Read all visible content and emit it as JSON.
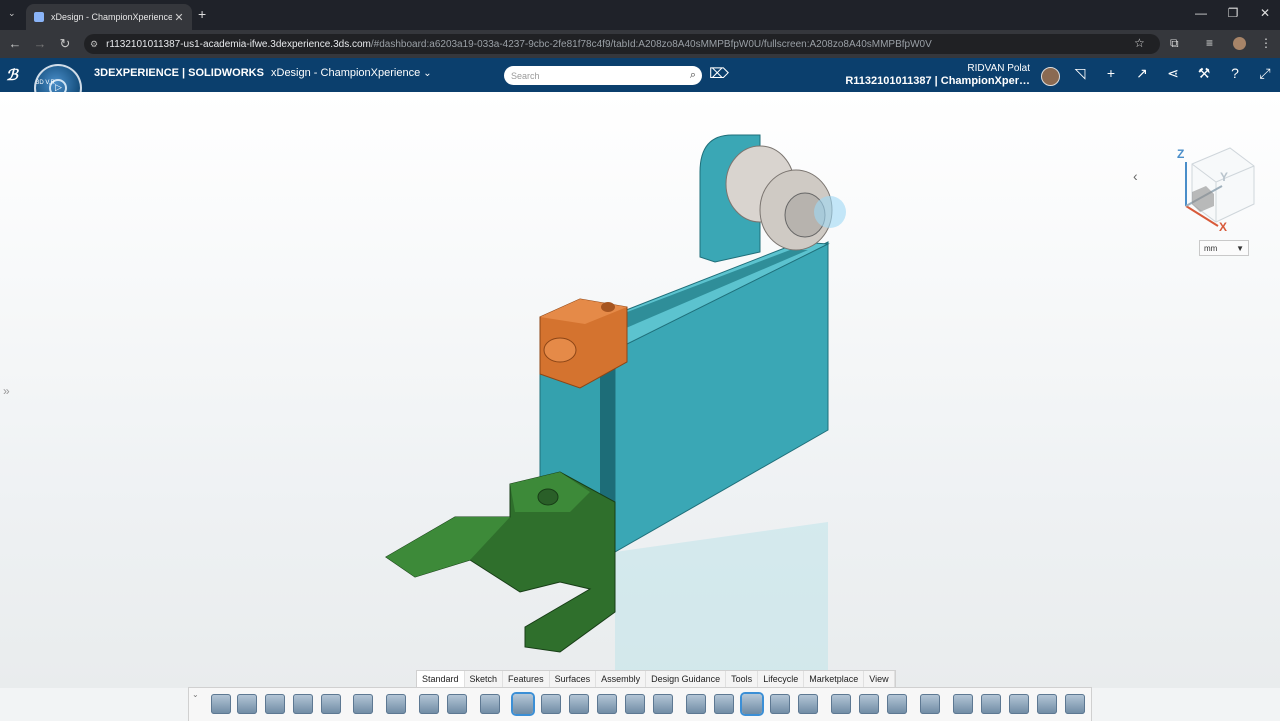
{
  "browser": {
    "tab_title": "xDesign - ChampionXperience",
    "new_tab": "+",
    "window_controls": [
      "—",
      "❐",
      "✕"
    ],
    "url_host": "r1132101011387-us1-academia-ifwe.3dexperience.3ds.com",
    "url_path": "/#dashboard:a6203a19-033a-4237-9cbc-2fe81f78c4f9/tabId:A208zo8A40sMMPBfpW0U/fullscreen:A208zo8A40sMMPBfpW0V"
  },
  "header": {
    "brand_prefix": "3D",
    "brand_experience": "EXPERIENCE | SOLIDWORKS",
    "app_title": "xDesign - ChampionXperience",
    "search_placeholder": "Search",
    "user_name": "RIDVAN Polat",
    "tenant": "R1132101011387 | ChampionXper…",
    "compass_label": "3D V,R"
  },
  "viewcube": {
    "axis_z": "Z",
    "axis_y": "Y",
    "axis_x": "X",
    "unit": "mm"
  },
  "action_tabs": [
    "Standard",
    "Sketch",
    "Features",
    "Surfaces",
    "Assembly",
    "Design Guidance",
    "Tools",
    "Lifecycle",
    "Marketplace",
    "View"
  ],
  "active_tab": "Standard",
  "colors": {
    "header_bg": "#0b3f6d",
    "part_teal": "#3aa7b5",
    "part_orange": "#d4732f",
    "part_green": "#2f6f2c",
    "wheel_gray": "#c8c8c8"
  }
}
